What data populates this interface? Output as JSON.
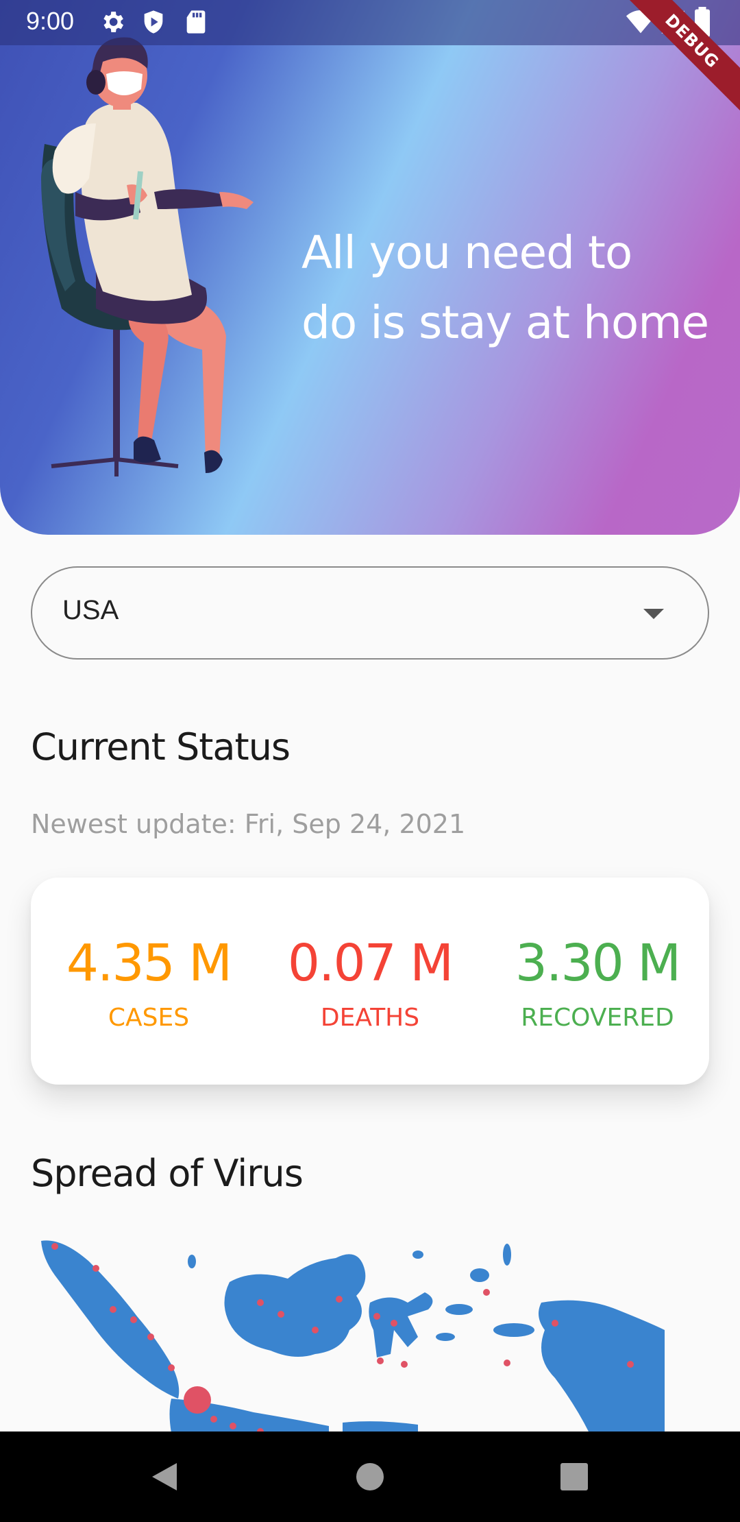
{
  "status_bar": {
    "time": "9:00",
    "icons_left": [
      "gear-icon",
      "shield-icon",
      "sd-card-icon"
    ],
    "icons_right": [
      "wifi-icon",
      "signal-icon",
      "battery-icon"
    ]
  },
  "debug_banner": "DEBUG",
  "hero": {
    "line1": "All you need to",
    "line2": "do is stay at home",
    "gradient_colors": [
      "#3f51b5",
      "#8fc9f5",
      "#b867c7"
    ]
  },
  "country_select": {
    "selected": "USA"
  },
  "current_status": {
    "title": "Current Status",
    "updated": "Newest update: Fri, Sep 24, 2021",
    "stats": [
      {
        "value": "4.35 M",
        "label": "CASES",
        "color": "#ff9800"
      },
      {
        "value": "0.07 M",
        "label": "DEATHS",
        "color": "#f44336"
      },
      {
        "value": "3.30 M",
        "label": "RECOVERED",
        "color": "#4caf50"
      }
    ]
  },
  "spread": {
    "title": "Spread of Virus",
    "map_color": "#3a84cf",
    "dot_color": "#e05265"
  },
  "nav": [
    "back-icon",
    "home-icon",
    "recents-icon"
  ]
}
